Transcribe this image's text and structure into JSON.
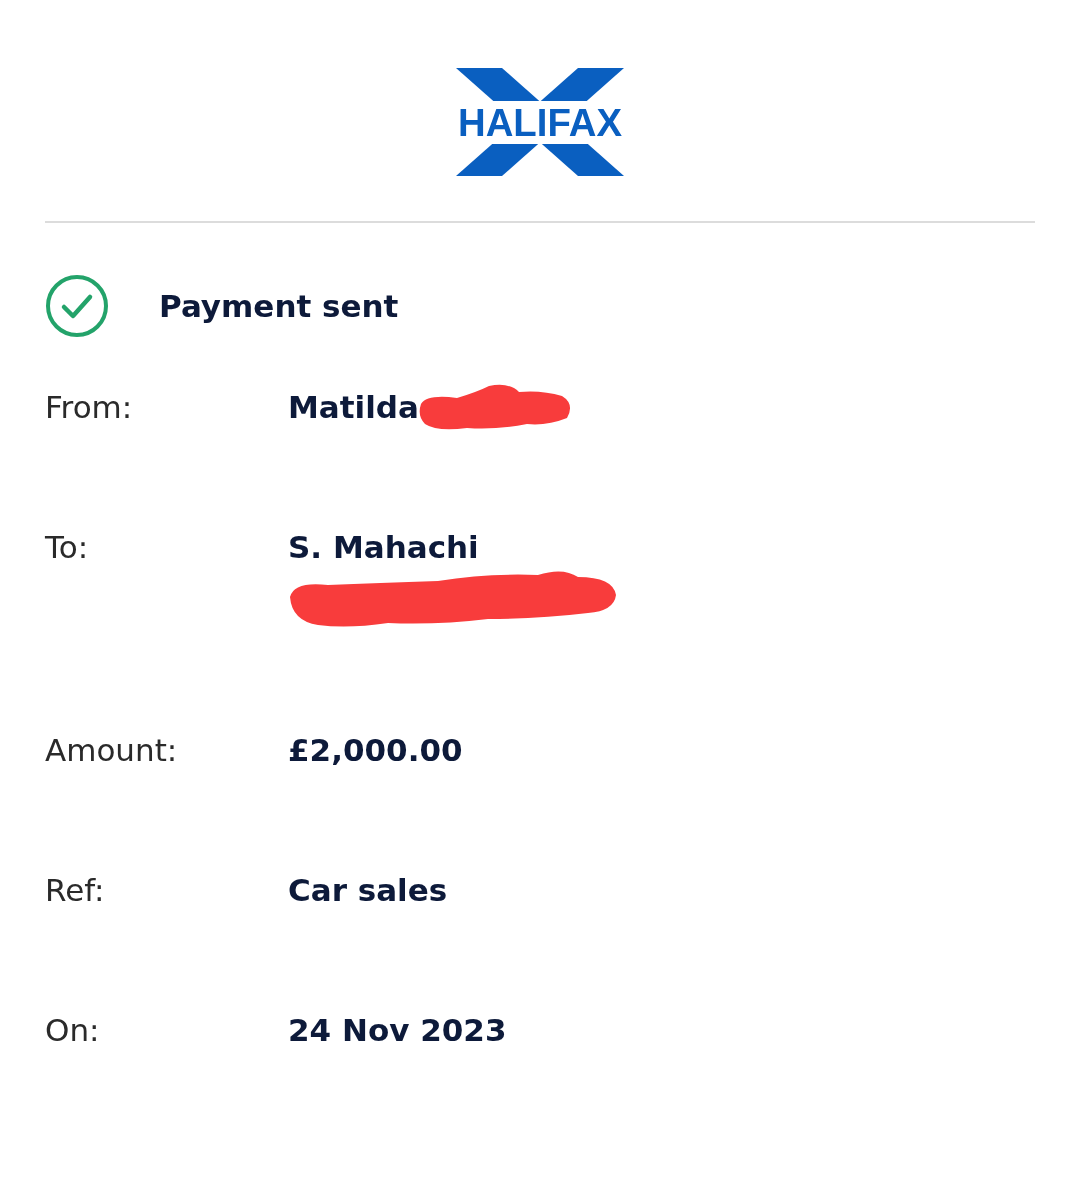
{
  "logo": {
    "text": "HALIFAX"
  },
  "status": {
    "title": "Payment sent",
    "success": true
  },
  "details": [
    {
      "label": "From:",
      "lines": [
        "Matilda"
      ],
      "tail_redacted": true,
      "line_redacted": false
    },
    {
      "label": "To:",
      "lines": [
        "S. Mahachi"
      ],
      "tail_redacted": false,
      "line_redacted": true
    },
    {
      "label": "Amount:",
      "lines": [
        "£2,000.00"
      ],
      "tail_redacted": false,
      "line_redacted": false
    },
    {
      "label": "Ref:",
      "lines": [
        "Car sales"
      ],
      "tail_redacted": false,
      "line_redacted": false
    },
    {
      "label": "On:",
      "lines": [
        "24 Nov 2023"
      ],
      "tail_redacted": false,
      "line_redacted": false
    }
  ]
}
